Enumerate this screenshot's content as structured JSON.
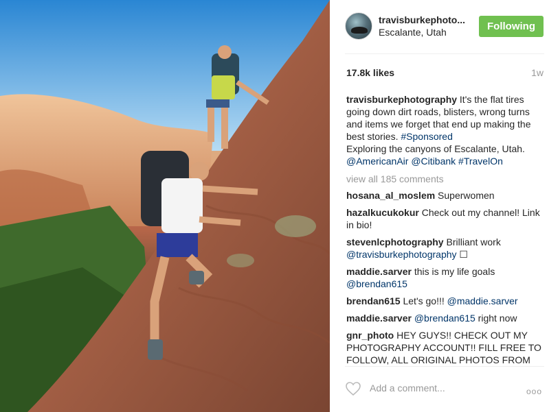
{
  "post": {
    "username": "travisburkephoto...",
    "location": "Escalante, Utah",
    "follow_label": "Following",
    "likes": "17.8k likes",
    "age": "1w",
    "caption": {
      "author": "travisburkephotography",
      "text_1": " It's the flat tires going down dirt roads, blisters, wrong turns and items we forget that end up making the best stories. ",
      "hashtag_sponsored": "#Sponsored",
      "text_2": "Exploring the canyons of Escalante, Utah.",
      "mention_1": "@AmericanAir",
      "mention_2": "@Citibank",
      "hashtag_travelon": "#TravelOn"
    },
    "view_all": "view all 185 comments",
    "comments": [
      {
        "author": "hosana_al_moslem",
        "text": " Superwomen"
      },
      {
        "author": "hazalkucukokur",
        "text": " Check out my channel! Link in bio!"
      },
      {
        "author": "stevenlcphotography",
        "text": " Brilliant work ",
        "mention": "@travisburkephotography",
        "tail": " ☐"
      },
      {
        "author": "maddie.sarver",
        "text": " this is my life goals ",
        "mention": "@brendan615"
      },
      {
        "author": "brendan615",
        "text": " Let's go!!! ",
        "mention": "@maddie.sarver"
      },
      {
        "author": "maddie.sarver",
        "text": " ",
        "mention": "@brendan615",
        "tail": " right now"
      },
      {
        "author": "gnr_photo",
        "text": " HEY GUYS!! CHECK OUT MY PHOTOGRAPHY ACCOUNT!! FILL FREE TO FOLLOW, ALL ORIGINAL PHOTOS FROM"
      }
    ],
    "add_comment_placeholder": "Add a comment...",
    "more_label": "ooo",
    "accent_follow": "#70c050",
    "link_color": "#003569"
  }
}
